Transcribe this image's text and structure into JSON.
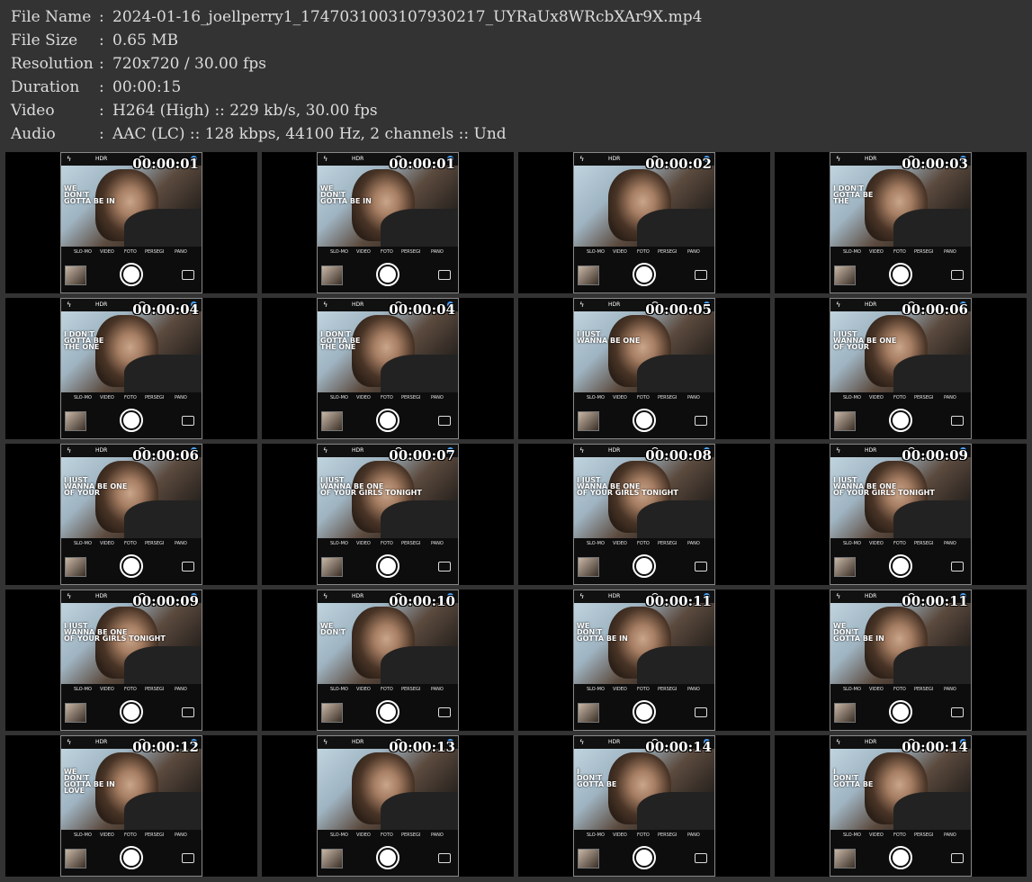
{
  "info": [
    {
      "label": "File Name",
      "value": "2024-01-16_joellperry1_1747031003107930217_UYRaUx8WRcbXAr9X.mp4"
    },
    {
      "label": "File Size",
      "value": "0.65 MB"
    },
    {
      "label": "Resolution",
      "value": "720x720 / 30.00 fps"
    },
    {
      "label": "Duration",
      "value": "00:00:15"
    },
    {
      "label": "Video",
      "value": "H264 (High) :: 229 kb/s, 30.00 fps"
    },
    {
      "label": "Audio",
      "value": "AAC (LC) :: 128 kbps, 44100 Hz, 2 channels :: Und"
    }
  ],
  "separator": ":",
  "camera_ui": {
    "hdr": "HDR",
    "modes": [
      "SLO-MO",
      "VIDEO",
      "FOTO",
      "PERSEGI",
      "PANO"
    ]
  },
  "thumbnails": [
    {
      "timestamp": "00:00:01",
      "overlay": "WE\nDON'T\nGOTTA BE IN"
    },
    {
      "timestamp": "00:00:01",
      "overlay": "WE\nDON'T\nGOTTA BE IN"
    },
    {
      "timestamp": "00:00:02",
      "overlay": ""
    },
    {
      "timestamp": "00:00:03",
      "overlay": "I DON'T\nGOTTA BE\nTHE"
    },
    {
      "timestamp": "00:00:04",
      "overlay": "I DON'T\nGOTTA BE\nTHE ONE"
    },
    {
      "timestamp": "00:00:04",
      "overlay": "I DON'T\nGOTTA BE\nTHE ONE"
    },
    {
      "timestamp": "00:00:05",
      "overlay": "I JUST\nWANNA BE ONE"
    },
    {
      "timestamp": "00:00:06",
      "overlay": "I JUST\nWANNA BE ONE\nOF YOUR"
    },
    {
      "timestamp": "00:00:06",
      "overlay": "I JUST\nWANNA BE ONE\nOF YOUR"
    },
    {
      "timestamp": "00:00:07",
      "overlay": "I JUST\nWANNA BE ONE\nOF YOUR GIRLS TONIGHT"
    },
    {
      "timestamp": "00:00:08",
      "overlay": "I JUST\nWANNA BE ONE\nOF YOUR GIRLS TONIGHT"
    },
    {
      "timestamp": "00:00:09",
      "overlay": "I JUST\nWANNA BE ONE\nOF YOUR GIRLS TONIGHT"
    },
    {
      "timestamp": "00:00:09",
      "overlay": "I JUST\nWANNA BE ONE\nOF YOUR GIRLS TONIGHT"
    },
    {
      "timestamp": "00:00:10",
      "overlay": "WE\nDON'T"
    },
    {
      "timestamp": "00:00:11",
      "overlay": "WE\nDON'T\nGOTTA BE IN"
    },
    {
      "timestamp": "00:00:11",
      "overlay": "WE\nDON'T\nGOTTA BE IN"
    },
    {
      "timestamp": "00:00:12",
      "overlay": "WE\nDON'T\nGOTTA BE IN\nLOVE"
    },
    {
      "timestamp": "00:00:13",
      "overlay": ""
    },
    {
      "timestamp": "00:00:14",
      "overlay": "I\nDON'T\nGOTTA BE"
    },
    {
      "timestamp": "00:00:14",
      "overlay": "I\nDON'T\nGOTTA BE"
    }
  ]
}
